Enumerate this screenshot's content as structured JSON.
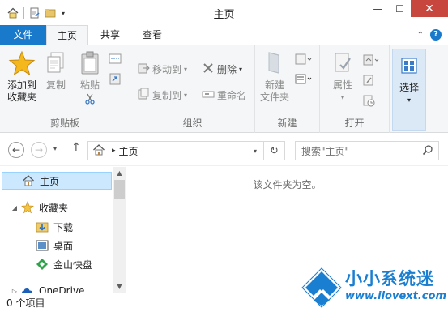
{
  "window": {
    "title": "主页"
  },
  "ribbon_tabs": {
    "file": "文件",
    "home": "主页",
    "share": "共享",
    "view": "查看"
  },
  "ribbon": {
    "clipboard": {
      "group": "剪贴板",
      "pin_line1": "添加到",
      "pin_line2": "收藏夹",
      "copy": "复制",
      "paste": "粘贴"
    },
    "organize": {
      "group": "组织",
      "move_to": "移动到",
      "copy_to": "复制到",
      "delete": "删除",
      "rename": "重命名"
    },
    "new": {
      "group": "新建",
      "new_folder_line1": "新建",
      "new_folder_line2": "文件夹"
    },
    "open": {
      "group": "打开",
      "properties": "属性"
    },
    "select": {
      "label": "选择"
    }
  },
  "address": {
    "crumb": "主页",
    "search_placeholder": "搜索\"主页\""
  },
  "nav": {
    "items": [
      {
        "label": "主页"
      },
      {
        "label": "收藏夹"
      },
      {
        "label": "下载"
      },
      {
        "label": "桌面"
      },
      {
        "label": "金山快盘"
      },
      {
        "label": "OneDrive"
      }
    ]
  },
  "content": {
    "empty_message": "该文件夹为空。"
  },
  "status": {
    "item_count": "0 个项目"
  },
  "watermark": {
    "title": "小小系统迷",
    "url": "www.ilovext.com"
  },
  "colors": {
    "accent": "#1979ca",
    "selection": "#cce8ff",
    "close": "#c7463d",
    "watermark": "#1a7fd1"
  }
}
